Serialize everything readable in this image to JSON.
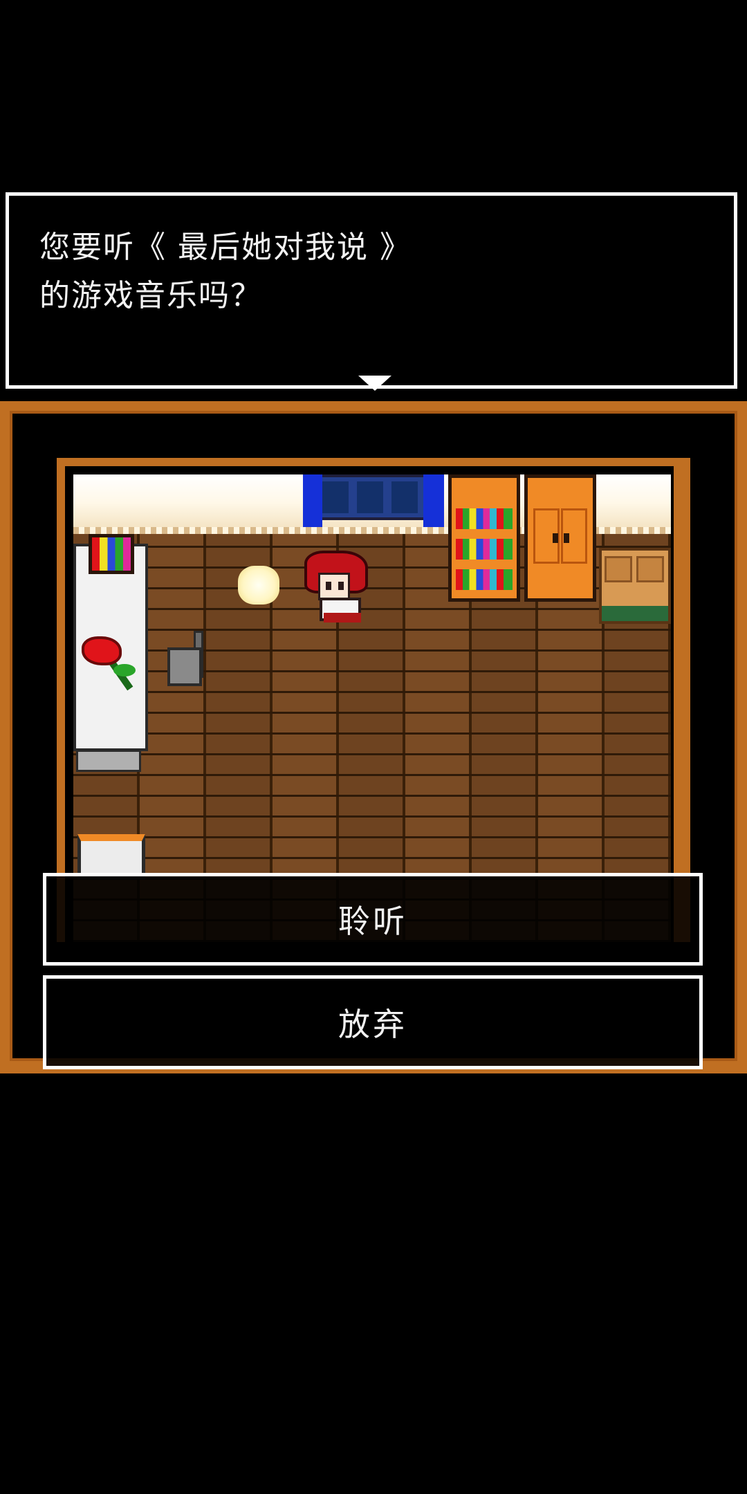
{
  "dialog": {
    "line1": "您要听《 最后她对我说 》",
    "line2": "的游戏音乐吗？"
  },
  "choices": [
    {
      "label": "聆听"
    },
    {
      "label": "放弃"
    }
  ],
  "colors": {
    "frame": "#c06f22",
    "floor": "#5b3514",
    "dialog_border": "#ffffff",
    "background": "#000000"
  },
  "scene": {
    "icons": [
      "window-icon",
      "curtain-icon",
      "bookshelf-icon",
      "wardrobe-icon",
      "desk-icon",
      "bed-icon",
      "rose-icon",
      "chair-icon",
      "light-orb-icon",
      "character-sprite",
      "pot-icon"
    ]
  }
}
